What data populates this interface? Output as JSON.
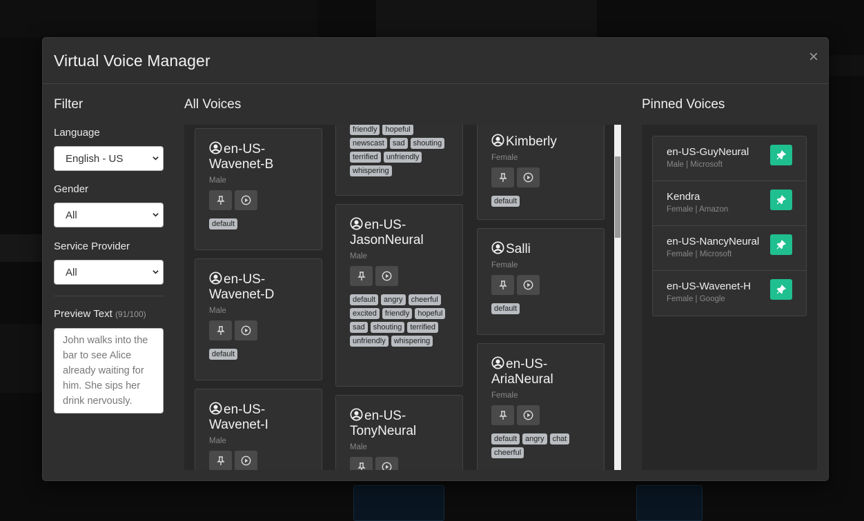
{
  "modal": {
    "title": "Virtual Voice Manager",
    "close_label": "×"
  },
  "filter": {
    "title": "Filter",
    "language_label": "Language",
    "language_value": "English - US",
    "gender_label": "Gender",
    "gender_value": "All",
    "provider_label": "Service Provider",
    "provider_value": "All",
    "preview_label": "Preview Text",
    "preview_count": "(91/100)",
    "preview_text": "John walks into the bar to see Alice already waiting for him. She sips her drink nervously."
  },
  "all_voices": {
    "title": "All Voices",
    "cards": [
      {
        "name": "en-US-Wavenet-B",
        "gender": "Male",
        "tags": [
          "default"
        ]
      },
      {
        "name": "en-US-Wavenet-D",
        "gender": "Male",
        "tags": [
          "default"
        ]
      },
      {
        "name": "en-US-Wavenet-I",
        "gender": "Male",
        "tags": []
      },
      {
        "name": "",
        "gender": "",
        "tags": [
          "friendly",
          "hopeful",
          "newscast",
          "sad",
          "shouting",
          "terrified",
          "unfriendly",
          "whispering"
        ]
      },
      {
        "name": "en-US-JasonNeural",
        "gender": "Male",
        "tags": [
          "default",
          "angry",
          "cheerful",
          "excited",
          "friendly",
          "hopeful",
          "sad",
          "shouting",
          "terrified",
          "unfriendly",
          "whispering"
        ]
      },
      {
        "name": "en-US-TonyNeural",
        "gender": "Male",
        "tags": []
      },
      {
        "name": "Kimberly",
        "gender": "Female",
        "tags": [
          "default"
        ]
      },
      {
        "name": "Salli",
        "gender": "Female",
        "tags": [
          "default"
        ]
      },
      {
        "name": "en-US-AriaNeural",
        "gender": "Female",
        "tags": [
          "default",
          "angry",
          "chat",
          "cheerful"
        ]
      }
    ]
  },
  "pinned": {
    "title": "Pinned Voices",
    "items": [
      {
        "name": "en-US-GuyNeural",
        "meta": "Male | Microsoft"
      },
      {
        "name": "Kendra",
        "meta": "Female | Amazon"
      },
      {
        "name": "en-US-NancyNeural",
        "meta": "Female | Microsoft"
      },
      {
        "name": "en-US-Wavenet-H",
        "meta": "Female | Google"
      }
    ]
  },
  "colors": {
    "accent": "#1fbf8f",
    "tag_bg": "#b9bcc0",
    "panel": "#272727",
    "card": "#303030"
  }
}
